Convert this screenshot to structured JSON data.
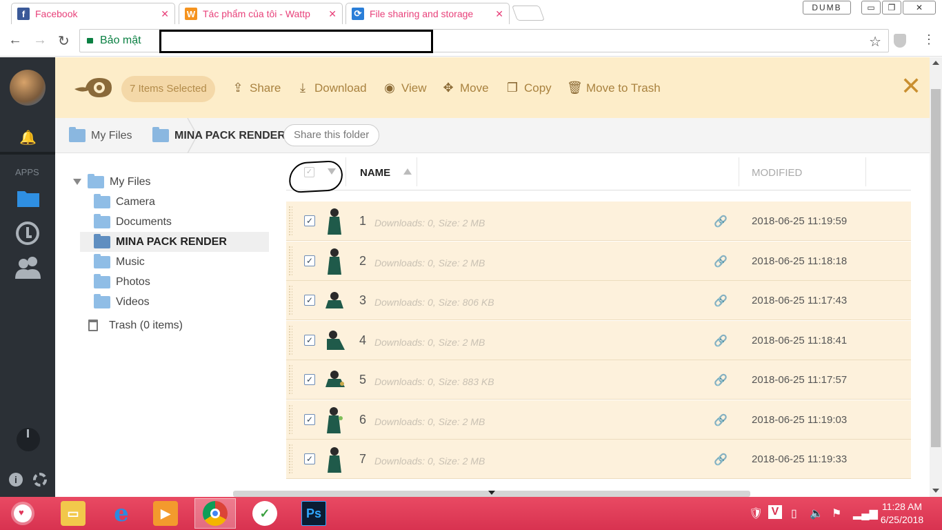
{
  "browser": {
    "tabs": [
      {
        "title": "Facebook",
        "icon": "facebook-icon",
        "color": "#3b5998",
        "glyph": "f"
      },
      {
        "title": "Tác phẩm của tôi - Wattp",
        "icon": "wattpad-icon",
        "color": "#f5931e",
        "glyph": "W"
      },
      {
        "title": "File sharing and storage",
        "icon": "pcloud-icon",
        "color": "#2a7ed8",
        "glyph": "⟳"
      }
    ],
    "profile_label": "DUMB",
    "security_label": "Bảo mật"
  },
  "app": {
    "apps_label": "APPS"
  },
  "toolbar": {
    "selected_label": "7 Items Selected",
    "actions": [
      {
        "label": "Share",
        "icon": "share-icon",
        "glyph": "⇪"
      },
      {
        "label": "Download",
        "icon": "download-icon",
        "glyph": "⤓"
      },
      {
        "label": "View",
        "icon": "eye-icon",
        "glyph": "◉"
      },
      {
        "label": "Move",
        "icon": "move-icon",
        "glyph": "✥"
      },
      {
        "label": "Copy",
        "icon": "copy-icon",
        "glyph": "❐"
      },
      {
        "label": "Move to Trash",
        "icon": "trash-icon",
        "glyph": "🗑"
      }
    ]
  },
  "breadcrumb": {
    "root": "My Files",
    "current": "MINA PACK RENDER",
    "share_button": "Share this folder"
  },
  "tree": {
    "root": "My Files",
    "children": [
      "Camera",
      "Documents",
      "MINA PACK RENDER",
      "Music",
      "Photos",
      "Videos"
    ],
    "selected": "MINA PACK RENDER",
    "trash": "Trash (0 items)"
  },
  "list": {
    "columns": {
      "name": "NAME",
      "modified": "MODIFIED"
    },
    "files": [
      {
        "name": "1",
        "meta": "Downloads: 0, Size: 2 MB",
        "modified": "2018-06-25 11:19:59"
      },
      {
        "name": "2",
        "meta": "Downloads: 0, Size: 2 MB",
        "modified": "2018-06-25 11:18:18"
      },
      {
        "name": "3",
        "meta": "Downloads: 0, Size: 806 KB",
        "modified": "2018-06-25 11:17:43"
      },
      {
        "name": "4",
        "meta": "Downloads: 0, Size: 2 MB",
        "modified": "2018-06-25 11:18:41"
      },
      {
        "name": "5",
        "meta": "Downloads: 0, Size: 883 KB",
        "modified": "2018-06-25 11:17:57"
      },
      {
        "name": "6",
        "meta": "Downloads: 0, Size: 2 MB",
        "modified": "2018-06-25 11:19:03"
      },
      {
        "name": "7",
        "meta": "Downloads: 0, Size: 2 MB",
        "modified": "2018-06-25 11:19:33"
      }
    ]
  },
  "taskbar": {
    "time": "11:28 AM",
    "date": "6/25/2018"
  },
  "colors": {
    "selection_bar": "#fdedc9",
    "row_selected": "#fdf1dc",
    "sidebar": "#2b3036",
    "taskbar": "#e1365a"
  }
}
